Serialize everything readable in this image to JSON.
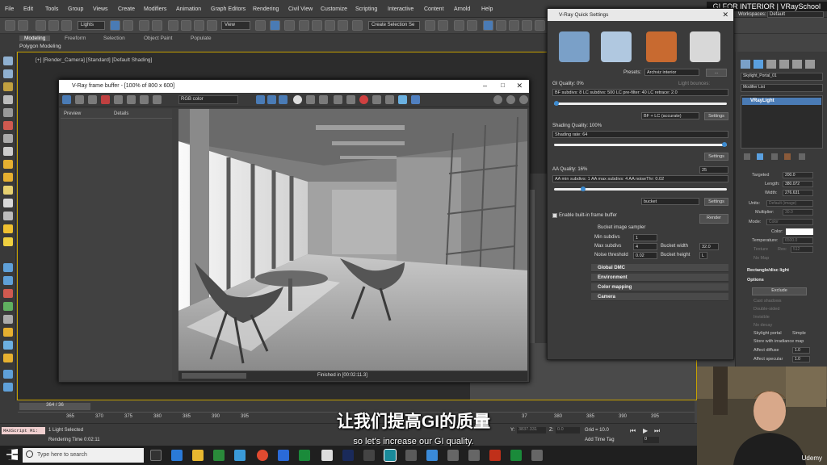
{
  "menu": [
    "File",
    "Edit",
    "Tools",
    "Group",
    "Views",
    "Create",
    "Modifiers",
    "Animation",
    "Graph Editors",
    "Rendering",
    "Civil View",
    "Customize",
    "Scripting",
    "Interactive",
    "Content",
    "Arnold",
    "Help"
  ],
  "brand": "GI FOR INTERIOR  |  VRaySchool",
  "workspaces": {
    "label": "Workspaces:",
    "value": "Default"
  },
  "toolbar": {
    "lights_select": "Lights",
    "view_select": "View",
    "selection_set": "Create Selection Se"
  },
  "ribbon": {
    "tabs": [
      "Modeling",
      "Freeform",
      "Selection",
      "Object Paint",
      "Populate"
    ],
    "sub": "Polygon Modeling"
  },
  "viewport_label": "[+] [Render_Camera] [Standard] [Default Shading]",
  "vfb": {
    "title": "V-Ray frame buffer - [100% of 800 x 600]",
    "channel": "RGB color",
    "cols": [
      "Preview",
      "Details"
    ],
    "status": "Finished in [00:02:11.3]"
  },
  "quick_settings": {
    "title": "V-Ray Quick Settings",
    "presets_label": "Presets:",
    "presets_value": "Archviz interior",
    "more_btn": "...",
    "gi_quality": "GI Quality: 0%",
    "light_bounces": "Light bounces:",
    "gi_info": "BF subdivs: 8   LC subdivs: 500   LC pre-filter: 40   LC retrace: 2.0",
    "gi_engine": "BF + LC (accurate)",
    "settings_btn": "Settings",
    "shading_quality": "Shading Quality: 100%",
    "shading_rate": "Shading rate: 64",
    "aa_quality": "AA Quality: 16%",
    "aa_value": "25",
    "aa_info": "AA min subdivs: 1   AA max subdivs: 4   AA noiseThr: 0.02",
    "sampler": "bucket",
    "enable_vfb": "Enable built-in frame buffer",
    "render_btn": "Render",
    "bucket_title": "Bucket image sampler",
    "min_subdivs_label": "Min subdivs",
    "min_subdivs": "1",
    "max_subdivs_label": "Max subdivs",
    "max_subdivs": "4",
    "noise_label": "Noise threshold",
    "noise": "0.02",
    "bw_label": "Bucket width",
    "bw": "32.0",
    "bh_label": "Bucket height",
    "bh": "L",
    "rollouts": [
      "Global DMC",
      "Environment",
      "Color mapping",
      "Camera"
    ],
    "gi_slider": 0.0,
    "shading_slider": 1.0,
    "aa_slider": 0.16
  },
  "command_panel": {
    "object_name": "Skylight_Portal_01",
    "modifier_list": "Modifier List",
    "stack_item": "VRayLight",
    "targeted": "Targeted",
    "targeted_val": "200.0",
    "length_label": "Length:",
    "length": "380.072",
    "width_label": "Width:",
    "width": "276.631",
    "units_label": "Units:",
    "units": "Default (image)",
    "mult_label": "Multiplier:",
    "mult": "30.0",
    "mode_label": "Mode:",
    "mode": "Color",
    "color_label": "Color:",
    "temp_label": "Temperature:",
    "temp": "6500.0",
    "texture_label": "Texture",
    "res_label": "Res:",
    "res": "512",
    "no_map": "No Map",
    "rect_rollout": "Rectangle/disc light",
    "options_rollout": "Options",
    "exclude_btn": "Exclude",
    "opts": [
      "Cast shadows",
      "Double-sided",
      "Invisible",
      "No decay",
      "Skylight portal",
      "Simple",
      "Store with irradiance map",
      "Affect diffuse",
      "Affect specular"
    ],
    "affect_diffuse_val": "1.0",
    "affect_spec_val": "1.0"
  },
  "timeline": {
    "frame": "364 / 36",
    "numbers": [
      "365",
      "370",
      "375",
      "380",
      "385",
      "390",
      "395"
    ],
    "right_numbers": [
      "37",
      "380",
      "385",
      "390",
      "395"
    ]
  },
  "status": {
    "maxscript": "MAXScript Mi:",
    "selected": "1 Light Selected",
    "render_time": "Rendering Time 0:02:11",
    "y": "Y:",
    "y_val": "3837.331",
    "z": "Z:",
    "z_val": "0.0",
    "grid": "Grid = 10.0",
    "add_time_tag": "Add Time Tag",
    "frame_val": "0"
  },
  "taskbar": {
    "search": "Type here to search"
  },
  "subtitle_cn": "让我们提高GI的质量",
  "subtitle_en": "so let's increase our GI quality.",
  "udemy": "Udemy"
}
